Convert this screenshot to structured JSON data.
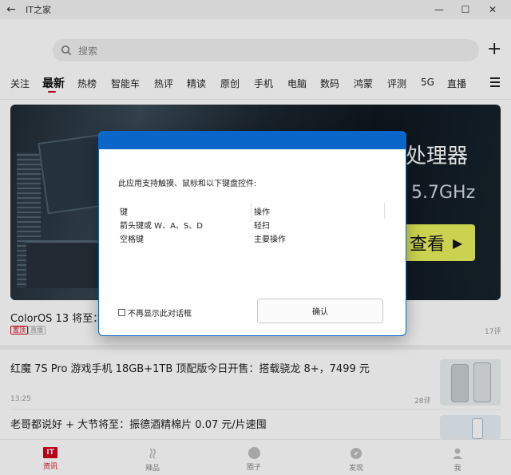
{
  "window": {
    "title": "IT之家"
  },
  "search": {
    "placeholder": "搜索"
  },
  "tabs": [
    {
      "label": "关注"
    },
    {
      "label": "最新"
    },
    {
      "label": "热榜"
    },
    {
      "label": "智能车"
    },
    {
      "label": "热评"
    },
    {
      "label": "精读"
    },
    {
      "label": "原创"
    },
    {
      "label": "手机"
    },
    {
      "label": "电脑"
    },
    {
      "label": "数码"
    },
    {
      "label": "鸿蒙"
    },
    {
      "label": "评测"
    },
    {
      "label": "5G"
    },
    {
      "label": "直播"
    }
  ],
  "active_tab": "最新",
  "banner": {
    "title": "处理器",
    "freq": "5.7GHz",
    "button": "查看"
  },
  "articles": [
    {
      "title": "ColorOS 13 将至：20",
      "tags": [
        "置顶",
        "直播"
      ],
      "comments": "17评"
    },
    {
      "title": "红魔 7S Pro 游戏手机 18GB+1TB 顶配版今日开售：搭载骁龙 8+，7499 元",
      "time": "13:25",
      "comments": "28评"
    },
    {
      "title": "老哥都说好 + 大节将至：振德酒精棉片 0.07 元/片速囤"
    }
  ],
  "bottom_nav": [
    {
      "label": "资讯",
      "icon": "it-logo-icon"
    },
    {
      "label": "辣品",
      "icon": "flame-icon"
    },
    {
      "label": "圈子",
      "icon": "circle-icon"
    },
    {
      "label": "发现",
      "icon": "compass-icon"
    },
    {
      "label": "我",
      "icon": "user-icon"
    }
  ],
  "dialog": {
    "message": "此应用支持触摸、鼠标和以下键盘控件:",
    "headers": [
      "键",
      "操作"
    ],
    "rows": [
      [
        "箭头键或 W、A、S、D",
        "轻扫"
      ],
      [
        "空格键",
        "主要操作"
      ]
    ],
    "checkbox_label": "不再显示此对话框",
    "confirm_label": "确认"
  },
  "colors": {
    "accent": "#d0021b",
    "dialog_header": "#0a66c8",
    "banner_button": "#e6ef5a"
  }
}
